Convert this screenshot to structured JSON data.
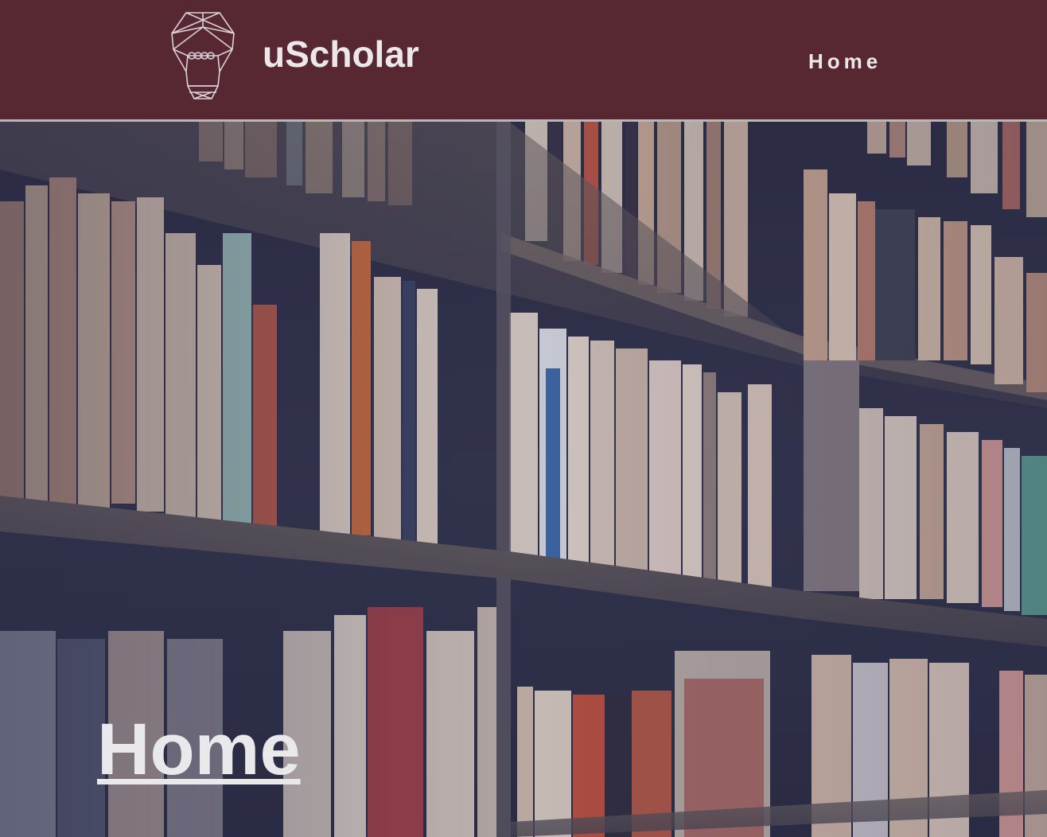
{
  "header": {
    "logo_icon": "lightbulb-geometric-icon",
    "brand_name": "uScholar",
    "background_color": "#572732",
    "nav": [
      {
        "label": "Home"
      }
    ]
  },
  "hero": {
    "background_image": "bookshelf-photo",
    "title": "Home"
  }
}
